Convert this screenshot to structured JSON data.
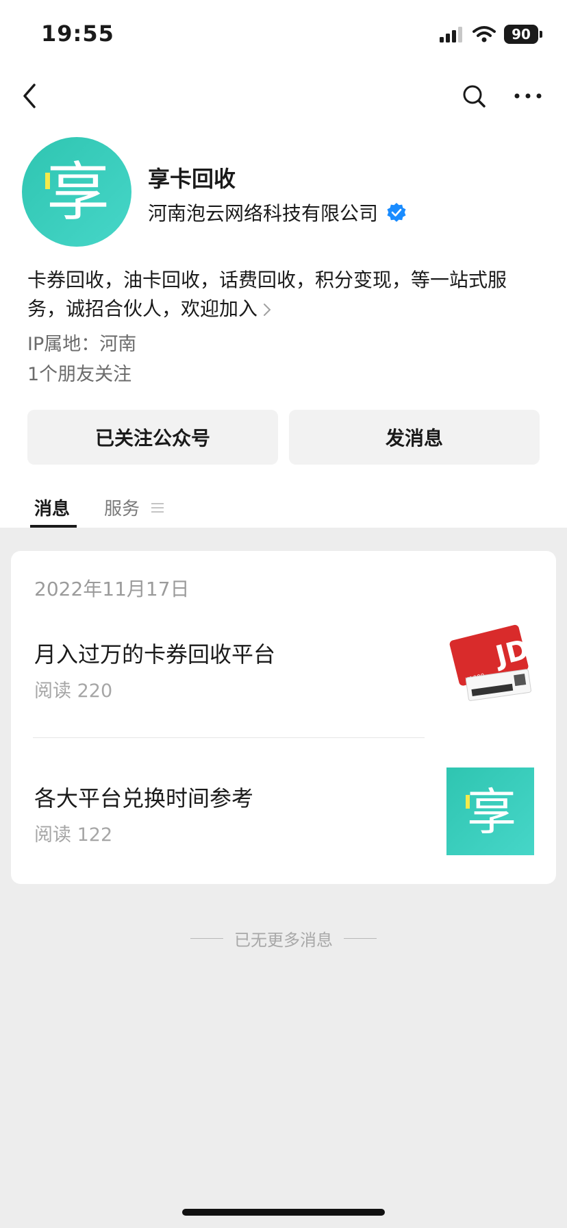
{
  "status_bar": {
    "time": "19:55",
    "battery": "90"
  },
  "nav": {
    "icons": [
      "back-icon",
      "search-icon",
      "more-icon"
    ]
  },
  "profile": {
    "avatar_glyph": "享",
    "name": "享卡回收",
    "company": "河南泡云网络科技有限公司",
    "description": "卡券回收，油卡回收，话费回收，积分变现，等一站式服务，诚招合伙人，欢迎加入",
    "ip_location": "IP属地：河南",
    "friends_following": "1个朋友关注"
  },
  "actions": {
    "follow_label": "已关注公众号",
    "message_label": "发消息"
  },
  "tabs": [
    {
      "label": "消息",
      "active": true
    },
    {
      "label": "服务",
      "active": false
    }
  ],
  "feed": {
    "date": "2022年11月17日",
    "articles": [
      {
        "title": "月入过万的卡券回收平台",
        "reads": "阅读 220",
        "thumb_label": "JD",
        "thumb_price": "¥1000"
      },
      {
        "title": "各大平台兑换时间参考",
        "reads": "阅读 122",
        "thumb_glyph": "享"
      }
    ],
    "end_text": "已无更多消息"
  },
  "colors": {
    "brand_teal": "#2fc5b1",
    "verified_blue": "#1a8cff",
    "jd_red": "#d92b2b",
    "page_bg": "#ededed"
  }
}
